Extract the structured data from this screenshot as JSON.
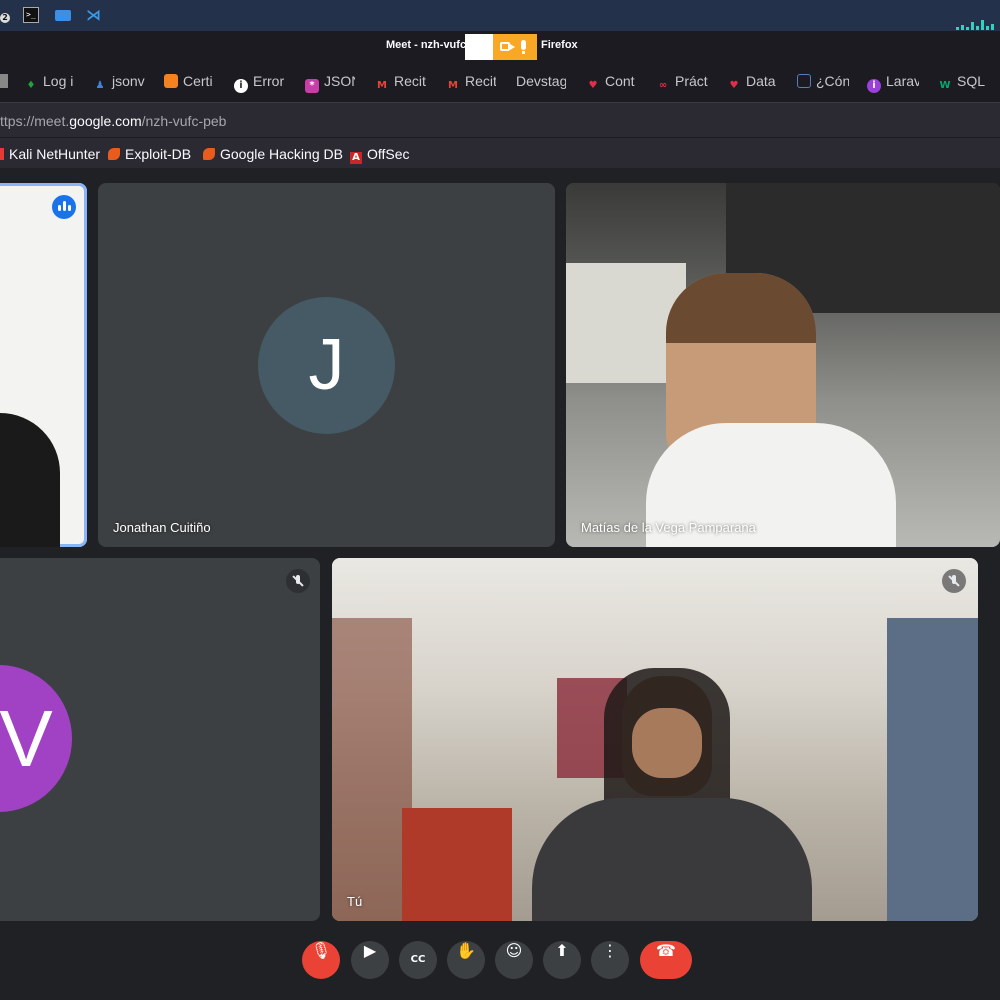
{
  "taskbar": {
    "workspace_badge": "2",
    "icons": [
      "workspace-icon",
      "terminal-icon",
      "folder-icon",
      "vscode-icon"
    ]
  },
  "window": {
    "title_left": "Meet - nzh-vufc",
    "title_right": "Firefox"
  },
  "tabs": [
    {
      "label": "Log i",
      "icon": "leaf-icon",
      "color": "#21a33a"
    },
    {
      "label": "jsonv",
      "icon": "person-icon",
      "color": "#3f87d6"
    },
    {
      "label": "Certi",
      "icon": "hexagon-icon",
      "color": "#f58220"
    },
    {
      "label": "Error",
      "icon": "info-icon",
      "color": "#ffffff"
    },
    {
      "label": "JSON",
      "icon": "json-icon",
      "color": "#c83ea8"
    },
    {
      "label": "Recit",
      "icon": "gmail-icon",
      "color": "#ea4335"
    },
    {
      "label": "Recit",
      "icon": "gmail-icon",
      "color": "#ea4335"
    },
    {
      "label": "Devstag",
      "icon": "",
      "color": ""
    },
    {
      "label": "Cont",
      "icon": "heart-icon",
      "color": "#e02f4a"
    },
    {
      "label": "Práct",
      "icon": "link-icon",
      "color": "#e0304a"
    },
    {
      "label": "Data",
      "icon": "heart-icon",
      "color": "#e02f4a"
    },
    {
      "label": "¿Cón",
      "icon": "window-icon",
      "color": "#5a7bbf"
    },
    {
      "label": "Larav",
      "icon": "laravel-icon",
      "color": "#9b40d8"
    },
    {
      "label": "SQL",
      "icon": "w3-icon",
      "color": "#04aa6d"
    }
  ],
  "url": {
    "prefix": "ttps://meet.",
    "domain": "google.com",
    "path": "/nzh-vufc-peb"
  },
  "bookmarks": [
    {
      "label": "Kali NetHunter",
      "icon": "kali-icon"
    },
    {
      "label": "Exploit-DB",
      "icon": "exploitdb-icon"
    },
    {
      "label": "Google Hacking DB",
      "icon": "exploitdb-icon"
    },
    {
      "label": "OffSec",
      "icon": "offsec-icon"
    }
  ],
  "participants": [
    {
      "name": "",
      "type": "video",
      "speaking": true
    },
    {
      "name": "Jonathan Cuitiño",
      "type": "avatar",
      "initial": "J",
      "avatar_color": "#455a64"
    },
    {
      "name": "Matías de la Vega Pamparana",
      "type": "video"
    },
    {
      "name": "",
      "type": "avatar",
      "initial": "V",
      "avatar_color": "#a142c4",
      "muted": true
    },
    {
      "name": "Tú",
      "type": "video",
      "muted": true
    }
  ],
  "controls": [
    {
      "id": "mic",
      "icon": "mic-off-icon",
      "state": "off"
    },
    {
      "id": "camera",
      "icon": "camera-icon"
    },
    {
      "id": "captions",
      "icon": "captions-icon"
    },
    {
      "id": "raise-hand",
      "icon": "hand-icon"
    },
    {
      "id": "reactions",
      "icon": "emoji-icon"
    },
    {
      "id": "present",
      "icon": "present-icon"
    },
    {
      "id": "more",
      "icon": "more-vert-icon"
    },
    {
      "id": "leave",
      "icon": "hangup-icon"
    }
  ]
}
